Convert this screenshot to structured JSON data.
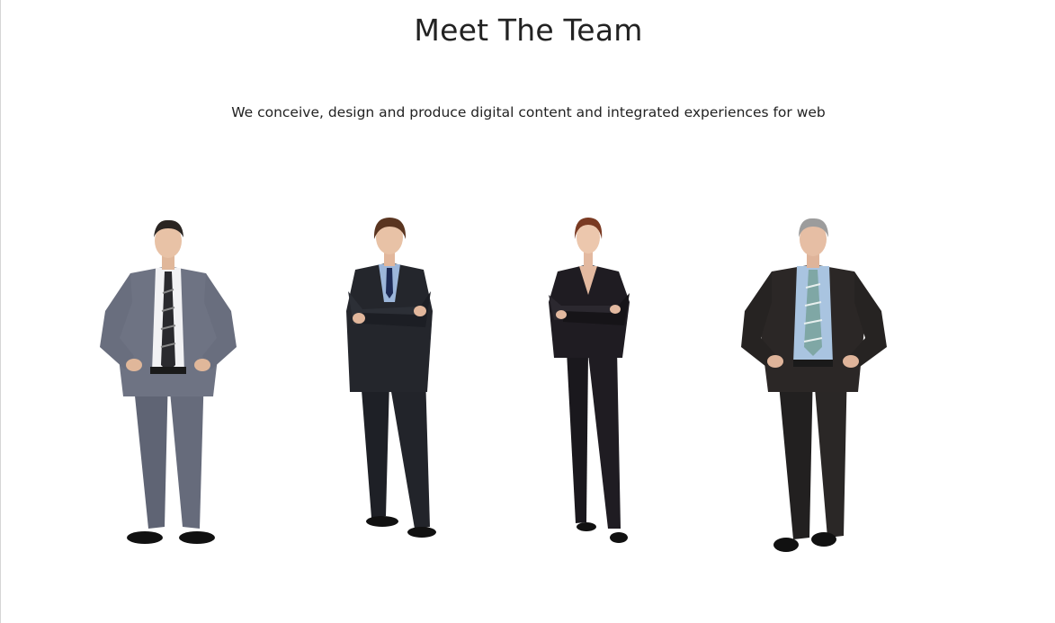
{
  "section": {
    "title": "Meet The Team",
    "subtitle": "We conceive, design and produce digital content and integrated experiences for web"
  },
  "team": [
    {
      "icon": "team-member-photo",
      "suit": "#6e7383",
      "shirt": "#f2f2f4",
      "tie": "#2a2a2e",
      "hair": "#2a2522"
    },
    {
      "icon": "team-member-photo",
      "suit": "#24262c",
      "shirt": "#9cb6da",
      "tie": "#1d2a55",
      "hair": "#5a3520"
    },
    {
      "icon": "team-member-photo",
      "suit": "#1f1c22",
      "shirt": "#1f1c22",
      "tie": "#1f1c22",
      "hair": "#7a3a22"
    },
    {
      "icon": "team-member-photo",
      "suit": "#2b2726",
      "shirt": "#a9c4e0",
      "tie": "#7fa7a5",
      "hair": "#9c9c9c"
    }
  ]
}
